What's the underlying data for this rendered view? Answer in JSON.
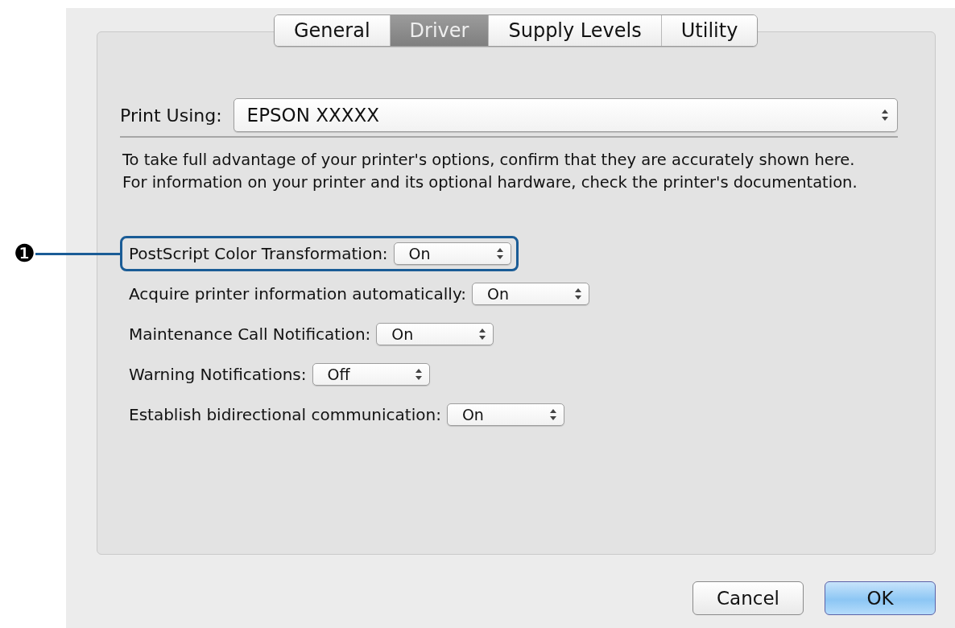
{
  "tabs": [
    {
      "label": "General",
      "selected": false
    },
    {
      "label": "Driver",
      "selected": true
    },
    {
      "label": "Supply Levels",
      "selected": false
    },
    {
      "label": "Utility",
      "selected": false
    }
  ],
  "print_using": {
    "label": "Print Using:",
    "value": "EPSON XXXXX"
  },
  "description": "To take full advantage of your printer's options, confirm that they are accurately shown here. For information on your printer and its optional hardware, check the printer's documentation.",
  "options": [
    {
      "label": "PostScript Color Transformation:",
      "value": "On",
      "highlighted": true,
      "callout": "❶"
    },
    {
      "label": "Acquire printer information automatically:",
      "value": "On",
      "highlighted": false
    },
    {
      "label": "Maintenance Call Notification:",
      "value": "On",
      "highlighted": false
    },
    {
      "label": "Warning Notifications:",
      "value": "Off",
      "highlighted": false
    },
    {
      "label": "Establish bidirectional communication:",
      "value": "On",
      "highlighted": false
    }
  ],
  "buttons": [
    {
      "label": "Cancel",
      "default": false
    },
    {
      "label": "OK",
      "default": true
    }
  ]
}
